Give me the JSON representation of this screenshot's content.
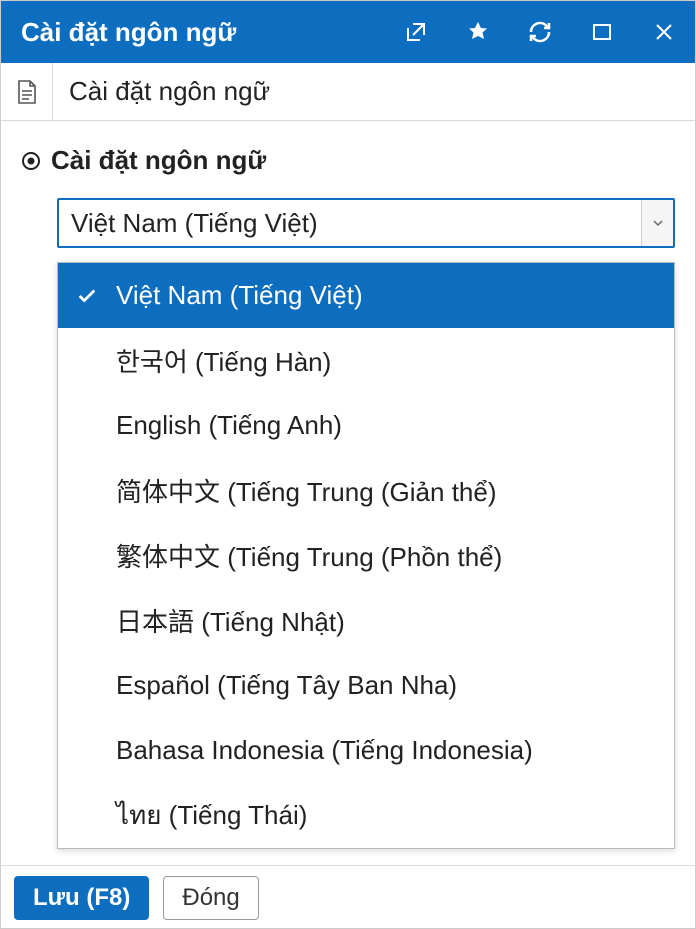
{
  "titlebar": {
    "title": "Cài đặt ngôn ngữ"
  },
  "subheader": {
    "title": "Cài đặt ngôn ngữ"
  },
  "section": {
    "label": "Cài đặt ngôn ngữ"
  },
  "select": {
    "value": "Việt Nam (Tiếng Việt)",
    "options": [
      {
        "label": "Việt Nam (Tiếng Việt)",
        "selected": true
      },
      {
        "label": "한국어 (Tiếng Hàn)",
        "selected": false
      },
      {
        "label": "English (Tiếng Anh)",
        "selected": false
      },
      {
        "label": "简体中文 (Tiếng Trung (Giản thể)",
        "selected": false
      },
      {
        "label": "繁体中文 (Tiếng Trung (Phồn thể)",
        "selected": false
      },
      {
        "label": "日本語 (Tiếng Nhật)",
        "selected": false
      },
      {
        "label": "Español (Tiếng Tây Ban Nha)",
        "selected": false
      },
      {
        "label": "Bahasa Indonesia (Tiếng Indonesia)",
        "selected": false
      },
      {
        "label": "ไทย (Tiếng Thái)",
        "selected": false
      }
    ]
  },
  "footer": {
    "save": "Lưu (F8)",
    "close": "Đóng"
  }
}
